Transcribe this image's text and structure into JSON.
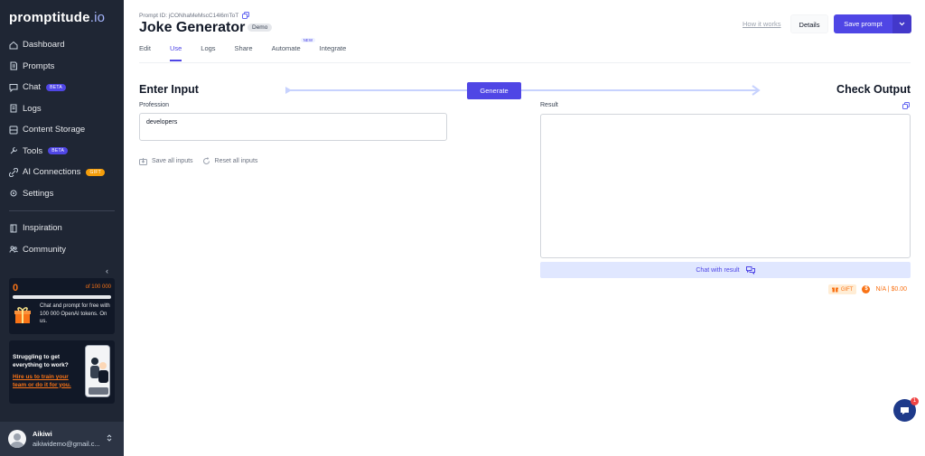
{
  "brand": {
    "logo_main": "promptitude",
    "logo_suffix": ".io",
    "accent": "#4f46e5",
    "sidebar_bg": "#1f2634"
  },
  "sidebar": {
    "items": [
      {
        "label": "Dashboard",
        "icon": "home-icon"
      },
      {
        "label": "Prompts",
        "icon": "prompts-icon"
      },
      {
        "label": "Chat",
        "icon": "chat-icon",
        "badge": "BETA"
      },
      {
        "label": "Logs",
        "icon": "logs-icon"
      },
      {
        "label": "Content Storage",
        "icon": "storage-icon"
      },
      {
        "label": "Tools",
        "icon": "tools-icon",
        "badge": "BETA"
      },
      {
        "label": "AI Connections",
        "icon": "connections-icon",
        "badge": "GIFT"
      },
      {
        "label": "Settings",
        "icon": "gear-icon"
      }
    ],
    "secondary": [
      {
        "label": "Inspiration",
        "icon": "inspiration-icon"
      },
      {
        "label": "Community",
        "icon": "community-icon"
      }
    ],
    "collapse_glyph": "‹",
    "credits": {
      "used": "0",
      "of": "of 100 000",
      "progress": 0.0,
      "description": "Chat and prompt for free with 100 000 OpenAI tokens. On us."
    },
    "promo": {
      "title": "Struggling to get everything to work?",
      "link": "Hire us to train your team or do it for you."
    },
    "user": {
      "name": "Aikiwi",
      "email": "aikiwidemo@gmail.c..."
    }
  },
  "header": {
    "prompt_id": "Prompt ID: jCONhaMeMscC14l6mToT",
    "title": "Joke Generator",
    "tag": "Demo",
    "how_it_works": "How it works",
    "details": "Details",
    "save": "Save prompt"
  },
  "tabs": [
    {
      "label": "Edit"
    },
    {
      "label": "Use",
      "active": true
    },
    {
      "label": "Logs"
    },
    {
      "label": "Share"
    },
    {
      "label": "Automate",
      "badge": "NEW"
    },
    {
      "label": "Integrate"
    }
  ],
  "input_section": {
    "title": "Enter Input",
    "field_label": "Profession",
    "field_value": "developers",
    "save_all": "Save all inputs",
    "reset_all": "Reset all inputs"
  },
  "generate_label": "Generate",
  "output_section": {
    "title": "Check Output",
    "result_label": "Result",
    "chat_with_result": "Chat with result",
    "gift": "GIFT",
    "cost": "N/A | $0.00",
    "coin_symbol": "$"
  },
  "support": {
    "unread": "1"
  }
}
